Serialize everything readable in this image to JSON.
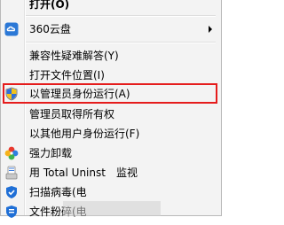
{
  "menu": {
    "items": [
      {
        "label": "打开(O)",
        "bold": true,
        "icon": "none"
      },
      {
        "label": "360云盘",
        "bold": false,
        "icon": "cloud-icon",
        "submenu": true
      },
      {
        "label": "兼容性疑难解答(Y)",
        "bold": false,
        "icon": "none"
      },
      {
        "label": "打开文件位置(I)",
        "bold": false,
        "icon": "none"
      },
      {
        "label": "以管理员身份运行(A)",
        "bold": false,
        "icon": "uac-shield-icon",
        "highlighted": true
      },
      {
        "label": "管理员取得所有权",
        "bold": false,
        "icon": "none"
      },
      {
        "label": "以其他用户身份运行(F)",
        "bold": false,
        "icon": "none"
      },
      {
        "label": "强力卸载",
        "bold": false,
        "icon": "clover-icon"
      },
      {
        "label": "用 Total Uninst",
        "bold": false,
        "icon": "total-uninstall-icon"
      },
      {
        "label": "扫描病毒(电",
        "bold": false,
        "icon": "shield-scan-icon"
      },
      {
        "label": "文件粉碎(电",
        "bold": false,
        "icon": "shield-shred-icon"
      }
    ],
    "overlay_text": "监视"
  },
  "colors": {
    "menu_bg": "#f3f3f3",
    "highlight_border": "#e51c1c",
    "cloud_icon": "#2b78d6"
  }
}
